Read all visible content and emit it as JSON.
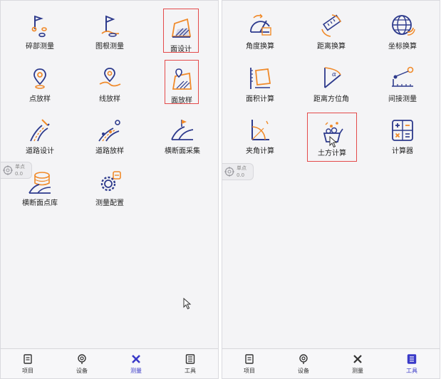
{
  "left_panel": {
    "items": [
      {
        "label": "碎部测量",
        "icon": "flags-icon"
      },
      {
        "label": "图根测量",
        "icon": "control-flag-icon"
      },
      {
        "label": "面设计",
        "icon": "area-design-icon"
      },
      {
        "label": "点放样",
        "icon": "point-pin-icon"
      },
      {
        "label": "线放样",
        "icon": "line-pin-icon"
      },
      {
        "label": "面放样",
        "icon": "area-pin-icon"
      },
      {
        "label": "道路设计",
        "icon": "road-design-icon"
      },
      {
        "label": "道路放样",
        "icon": "road-stakeout-icon"
      },
      {
        "label": "横断面采集",
        "icon": "cross-section-collect-icon"
      },
      {
        "label": "横断面点库",
        "icon": "cross-section-library-icon"
      },
      {
        "label": "测量配置",
        "icon": "settings-gear-icon"
      }
    ],
    "floater": {
      "line1": "单点",
      "line2": "0.0"
    },
    "tabs": [
      {
        "label": "项目",
        "icon": "project-icon"
      },
      {
        "label": "设备",
        "icon": "device-icon"
      },
      {
        "label": "测量",
        "icon": "measure-icon",
        "active": true
      },
      {
        "label": "工具",
        "icon": "tools-icon"
      }
    ]
  },
  "right_panel": {
    "items": [
      {
        "label": "角度换算",
        "icon": "angle-convert-icon"
      },
      {
        "label": "距离换算",
        "icon": "distance-convert-icon"
      },
      {
        "label": "坐标换算",
        "icon": "globe-coordinate-icon"
      },
      {
        "label": "面积计算",
        "icon": "area-calc-icon"
      },
      {
        "label": "距离方位角",
        "icon": "distance-bearing-icon"
      },
      {
        "label": "间接测量",
        "icon": "indirect-measure-icon"
      },
      {
        "label": "夹角计算",
        "icon": "included-angle-icon"
      },
      {
        "label": "土方计算",
        "icon": "earthwork-icon"
      },
      {
        "label": "计算器",
        "icon": "calculator-icon"
      }
    ],
    "floater": {
      "line1": "单点",
      "line2": "0.0"
    },
    "tabs": [
      {
        "label": "项目",
        "icon": "project-icon"
      },
      {
        "label": "设备",
        "icon": "device-icon"
      },
      {
        "label": "测量",
        "icon": "measure-icon"
      },
      {
        "label": "工具",
        "icon": "tools-icon",
        "active": true
      }
    ]
  },
  "colors": {
    "accent_orange": "#f08a2a",
    "icon_navy": "#2d3a8c",
    "highlight_red": "#e44a4a",
    "active_blue": "#3a3ac8"
  }
}
